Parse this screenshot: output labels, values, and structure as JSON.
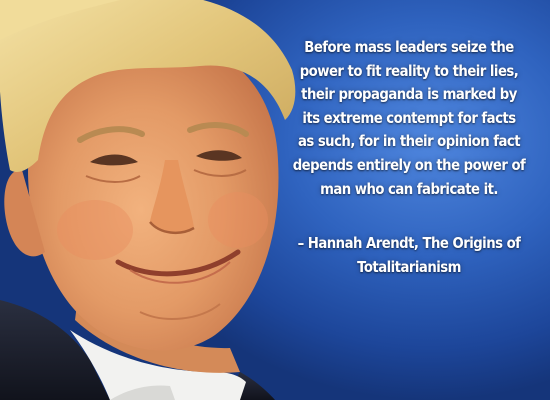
{
  "quote": {
    "text": "Before mass leaders seize the\npower to fit reality to their lies,\ntheir propaganda is marked by\nits extreme contempt for facts\nas such, for in their opinion fact\ndepends entirely on the power of\nman who can fabricate it.",
    "attribution": "– Hannah Arendt, The Origins of\nTotalitarianism"
  },
  "colors": {
    "background": "#2f63bf",
    "text": "#ffffff",
    "suit": "#1a1e2c",
    "shirt": "#f2f2f0",
    "hair": "#e8cf86",
    "skin": "#e8a06e"
  }
}
